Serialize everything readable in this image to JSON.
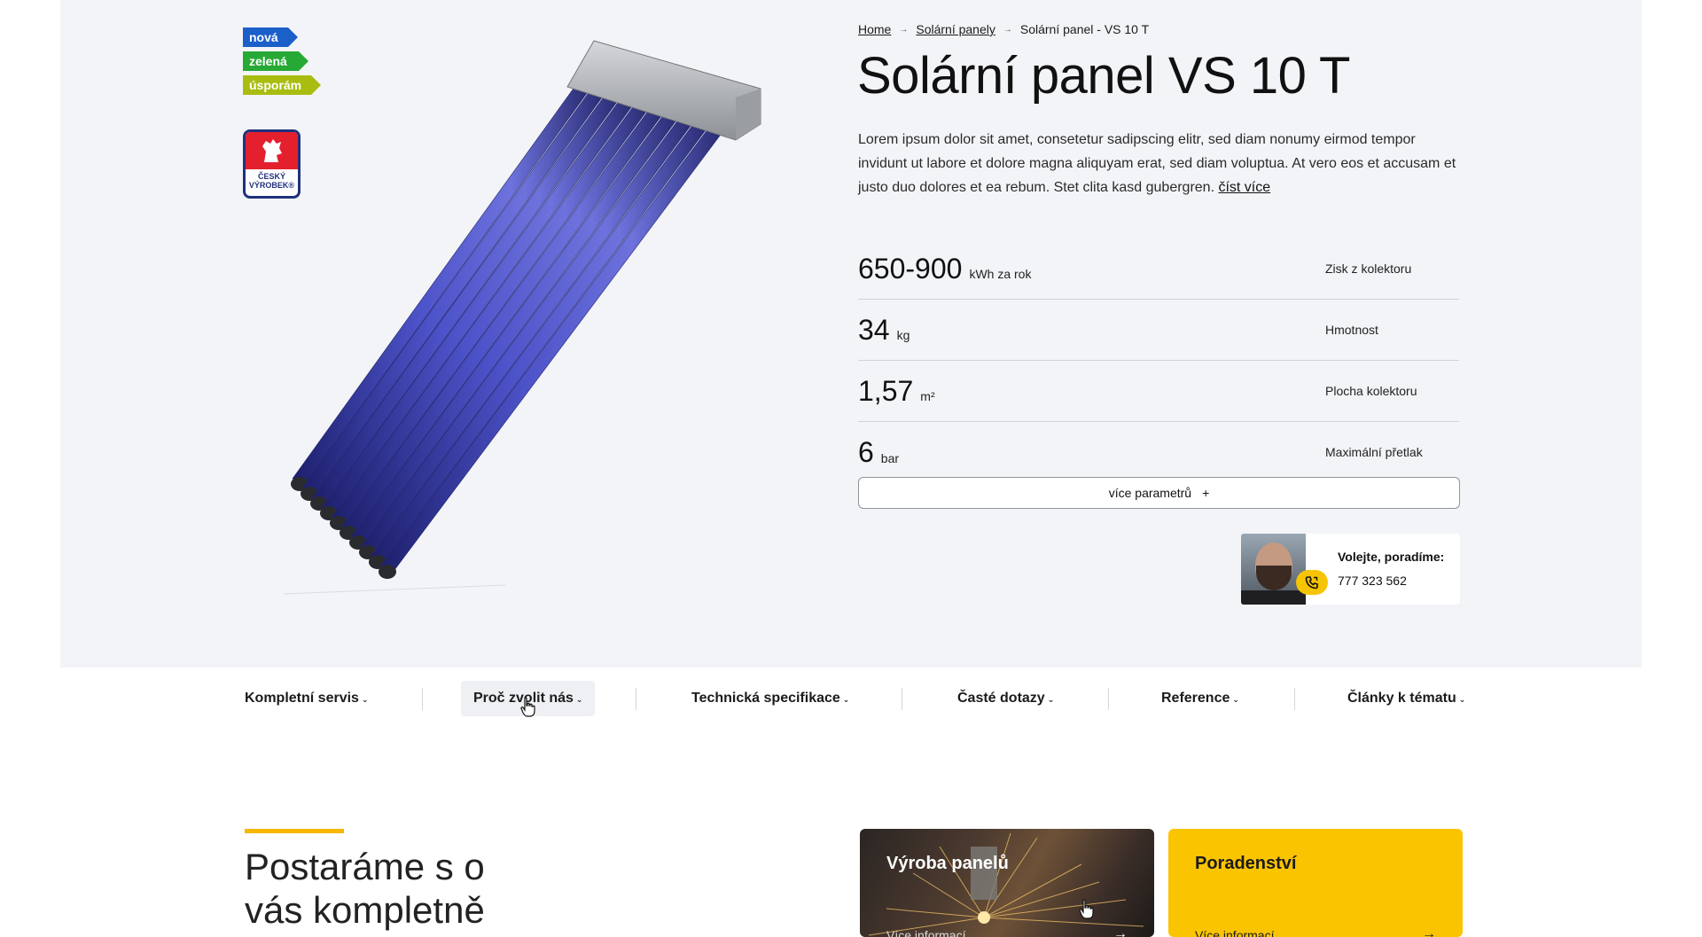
{
  "badges": [
    "nová",
    "zelená",
    "úsporám"
  ],
  "cz_logo": {
    "line1": "ČESKÝ",
    "line2": "VÝROBEK®"
  },
  "breadcrumb": [
    "Home",
    "Solární panely",
    "Solární panel - VS 10 T"
  ],
  "title": "Solární panel VS 10 T",
  "description": "Lorem ipsum dolor sit amet, consetetur sadipscing elitr, sed diam nonumy eirmod tempor invidunt ut labore et dolore magna aliquyam erat, sed diam voluptua. At vero eos et accusam et justo duo dolores et ea rebum. Stet clita kasd gubergren.",
  "read_more": "číst více",
  "params": [
    {
      "value": "650-900",
      "unit": "kWh za rok",
      "label": "Zisk z kolektoru"
    },
    {
      "value": "34",
      "unit": "kg",
      "label": "Hmotnost"
    },
    {
      "value": "1,57",
      "unit": "m²",
      "label": "Plocha kolektoru"
    },
    {
      "value": "6",
      "unit": "bar",
      "label": "Maximální přetlak"
    }
  ],
  "more_params": "více parametrů",
  "more_params_icon": "+",
  "contact": {
    "label": "Volejte, poradíme:",
    "phone": "777 323 562"
  },
  "tabs": [
    "Kompletní servis",
    "Proč zvolit nás",
    "Technická specifikace",
    "Časté dotazy",
    "Reference",
    "Články k tématu"
  ],
  "section_title": "Postaráme s o vás kompletně",
  "cards": [
    {
      "title": "Výroba panelů",
      "link": "Více informací"
    },
    {
      "title": "Poradenství",
      "link": "Více informací"
    }
  ],
  "colors": {
    "accent": "#f6c400",
    "hero_bg": "#f3f4f7",
    "badge_blue": "#1b5fc9",
    "badge_green": "#27a935",
    "badge_lime": "#a9bd10"
  }
}
